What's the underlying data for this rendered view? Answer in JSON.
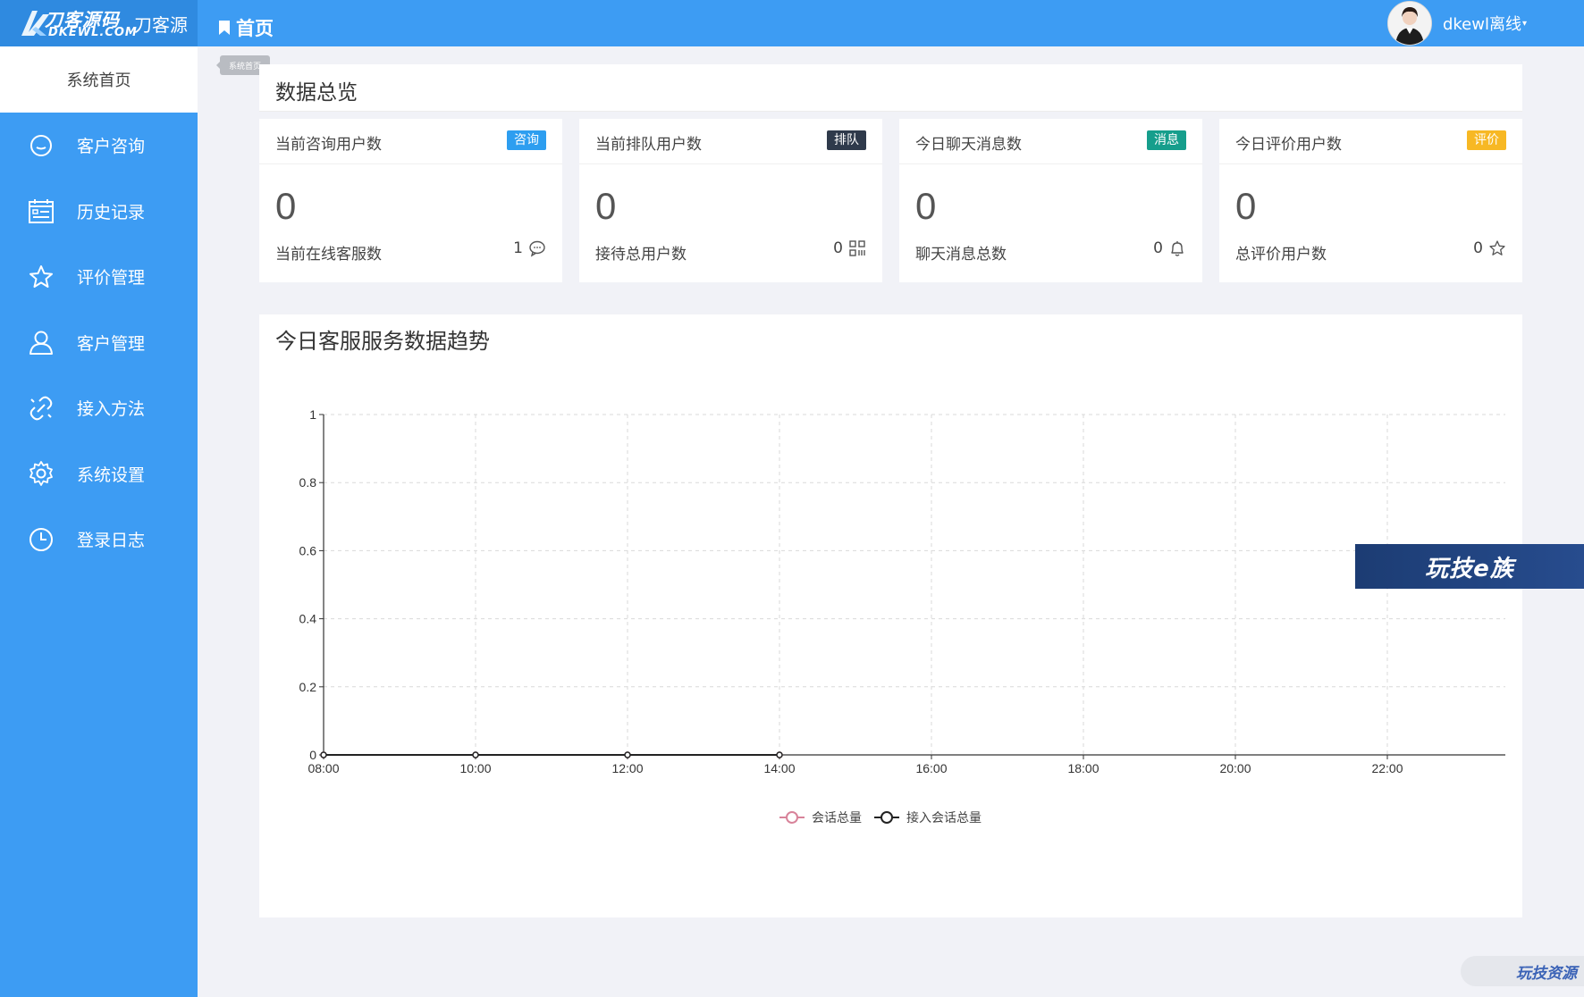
{
  "header": {
    "logo_brand": "刀客源码",
    "logo_url": "DKEWL.COM",
    "logo_name": "刀客源",
    "page_title": "首页",
    "username": "dkewl离线",
    "caret": "▾"
  },
  "sidebar": {
    "home_label": "系统首页",
    "items": [
      {
        "label": "客户咨询",
        "icon": "chat-bubble-icon"
      },
      {
        "label": "历史记录",
        "icon": "calendar-list-icon"
      },
      {
        "label": "评价管理",
        "icon": "star-icon"
      },
      {
        "label": "客户管理",
        "icon": "user-icon"
      },
      {
        "label": "接入方法",
        "icon": "link-icon"
      },
      {
        "label": "系统设置",
        "icon": "gear-icon"
      },
      {
        "label": "登录日志",
        "icon": "clock-icon"
      }
    ]
  },
  "tab_chip": "系统首页",
  "overview": {
    "title": "数据总览",
    "cards": [
      {
        "label": "当前咨询用户数",
        "badge": "咨询",
        "badge_color": "#2d9ef0",
        "value": "0",
        "sub_label": "当前在线客服数",
        "sub_value": "1",
        "icon": "message-icon"
      },
      {
        "label": "当前排队用户数",
        "badge": "排队",
        "badge_color": "#2f3a4b",
        "value": "0",
        "sub_label": "接待总用户数",
        "sub_value": "0",
        "icon": "qrcode-icon"
      },
      {
        "label": "今日聊天消息数",
        "badge": "消息",
        "badge_color": "#169e8c",
        "value": "0",
        "sub_label": "聊天消息总数",
        "sub_value": "0",
        "icon": "bell-icon"
      },
      {
        "label": "今日评价用户数",
        "badge": "评价",
        "badge_color": "#f7b824",
        "value": "0",
        "sub_label": "总评价用户数",
        "sub_value": "0",
        "icon": "star-outline-icon"
      }
    ]
  },
  "chart_title": "今日客服服务数据趋势",
  "chart_data": {
    "type": "line",
    "x": [
      "08:00",
      "10:00",
      "12:00",
      "14:00",
      "16:00",
      "18:00",
      "20:00",
      "22:00"
    ],
    "ylim": [
      0,
      1
    ],
    "yticks": [
      "0",
      "0.2",
      "0.4",
      "0.6",
      "0.8",
      "1"
    ],
    "grid": true,
    "legend_position": "bottom-center",
    "series": [
      {
        "name": "会话总量",
        "color": "#d8839a",
        "values": [
          0,
          0,
          0,
          0
        ]
      },
      {
        "name": "接入会话总量",
        "color": "#222222",
        "values": [
          0,
          0,
          0,
          0
        ]
      }
    ]
  },
  "promo_banner": "玩技e族",
  "watermark": "玩技资源"
}
